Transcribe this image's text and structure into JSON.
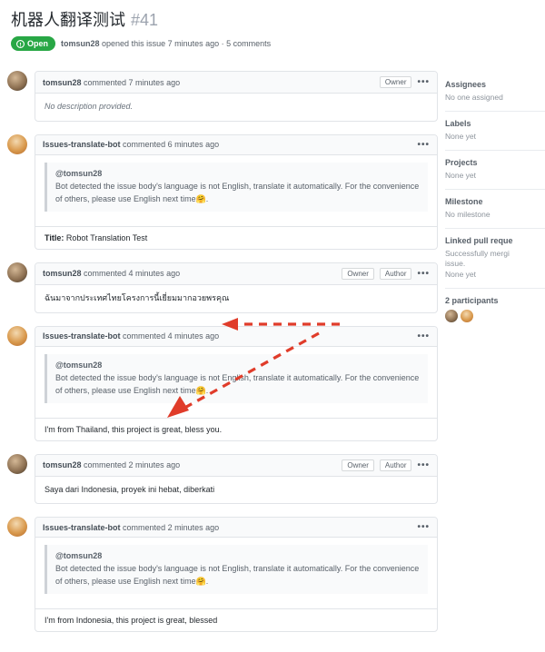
{
  "header": {
    "title": "机器人翻译测试",
    "issue_number": "#41",
    "state_label": "Open",
    "opener": "tomsun28",
    "opened_line_a": " opened this issue 7 minutes ago · ",
    "opened_line_b": "5 comments"
  },
  "comments": [
    {
      "author": "tomsun28",
      "time": "commented 7 minutes ago",
      "roles": [
        "Owner"
      ],
      "avatar": "user",
      "body_empty": "No description provided."
    },
    {
      "author": "Issues-translate-bot",
      "time": "commented 6 minutes ago",
      "roles": [],
      "avatar": "bot",
      "quote_mention": "@tomsun28",
      "quote_body": "Bot detected the issue body's language is not English, translate it automatically. For the convenience of others, please use English next time🤗.",
      "sub_title_label": "Title:",
      "sub_title_value": "Robot Translation Test"
    },
    {
      "author": "tomsun28",
      "time": "commented 4 minutes ago",
      "roles": [
        "Owner",
        "Author"
      ],
      "avatar": "user",
      "body": "ฉันมาจากประเทศไทยโครงการนี้เยี่ยมมากอวยพรคุณ"
    },
    {
      "author": "Issues-translate-bot",
      "time": "commented 4 minutes ago",
      "roles": [],
      "avatar": "bot",
      "quote_mention": "@tomsun28",
      "quote_body": "Bot detected the issue body's language is not English, translate it automatically. For the convenience of others, please use English next time🤗.",
      "sub_plain": "I'm from Thailand, this project is great, bless you."
    },
    {
      "author": "tomsun28",
      "time": "commented 2 minutes ago",
      "roles": [
        "Owner",
        "Author"
      ],
      "avatar": "user",
      "body": "Saya dari Indonesia, proyek ini hebat, diberkati"
    },
    {
      "author": "Issues-translate-bot",
      "time": "commented 2 minutes ago",
      "roles": [],
      "avatar": "bot",
      "quote_mention": "@tomsun28",
      "quote_body": "Bot detected the issue body's language is not English, translate it automatically. For the convenience of others, please use English next time🤗.",
      "sub_plain": "I'm from Indonesia, this project is great, blessed"
    }
  ],
  "sidebar": {
    "assignees": {
      "title": "Assignees",
      "body": "No one assigned"
    },
    "labels": {
      "title": "Labels",
      "body": "None yet"
    },
    "projects": {
      "title": "Projects",
      "body": "None yet"
    },
    "milestone": {
      "title": "Milestone",
      "body": "No milestone"
    },
    "linked_pr": {
      "title": "Linked pull reque",
      "body1": "Successfully mergi",
      "body2": "issue.",
      "body3": "None yet"
    },
    "participants_title": "2 participants"
  },
  "icon_chars": {
    "kebab": "•••"
  }
}
